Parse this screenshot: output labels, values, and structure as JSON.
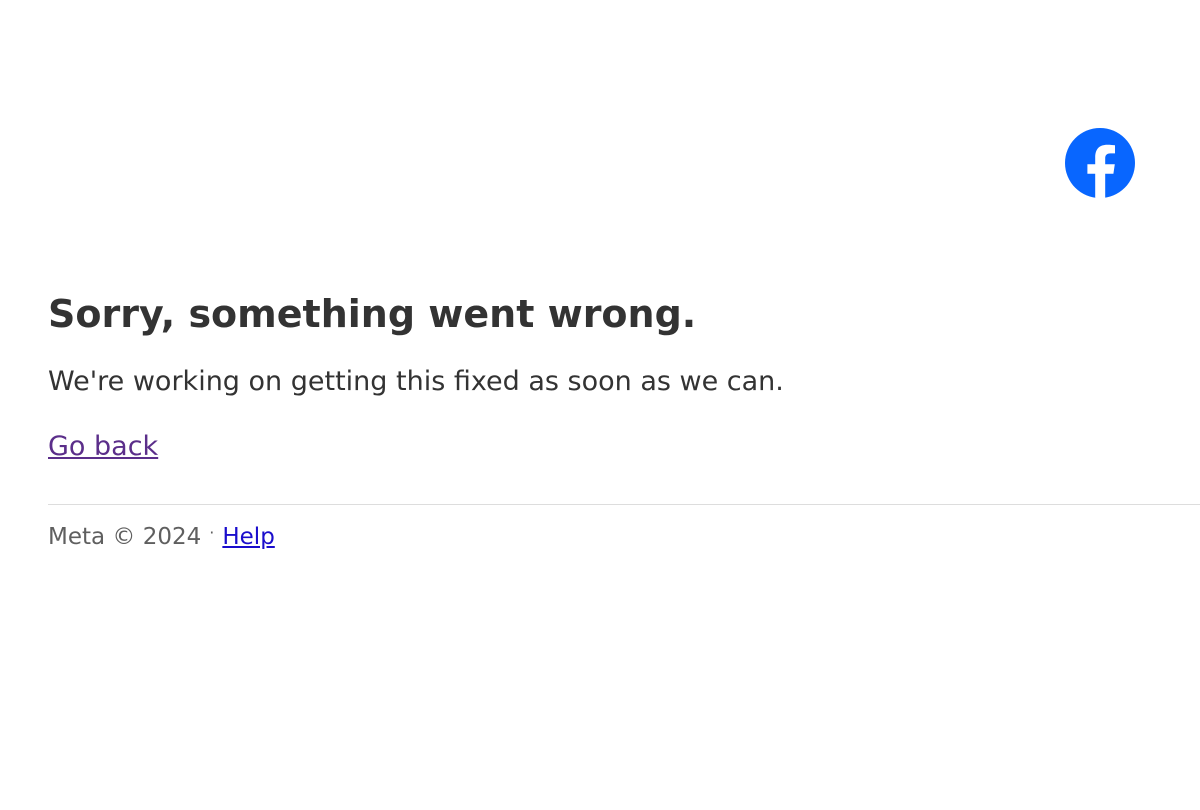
{
  "logo": {
    "icon": "facebook-logo-icon",
    "color": "#0866FF"
  },
  "error": {
    "title": "Sorry, something went wrong.",
    "message": "We're working on getting this fixed as soon as we can.",
    "back_link": "Go back"
  },
  "footer": {
    "copyright": "Meta © 2024",
    "separator": "·",
    "help_link": "Help"
  },
  "colors": {
    "text": "#333333",
    "visited_link": "#5b2e8a",
    "link": "#1a0dcc",
    "footer_text": "#5f5f5f",
    "divider": "#dddddd"
  }
}
